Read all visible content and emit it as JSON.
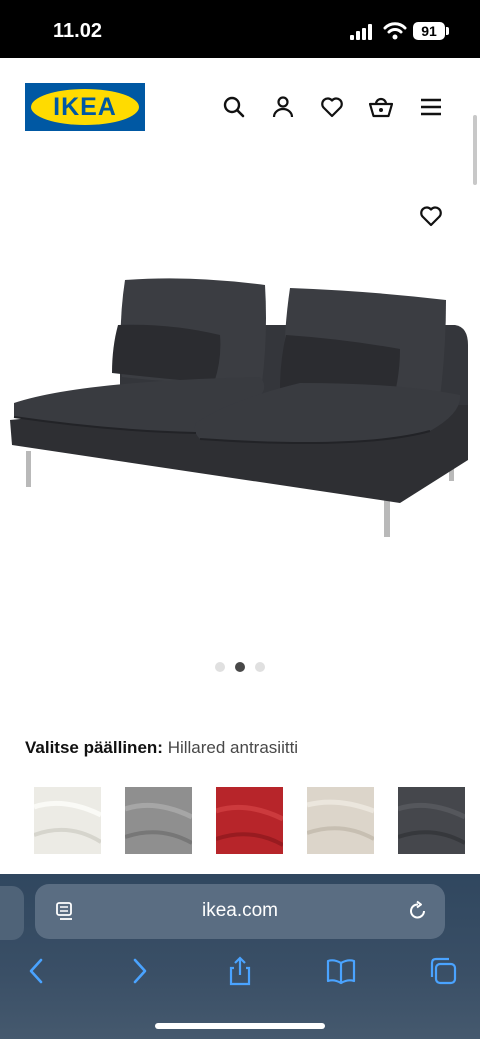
{
  "status_bar": {
    "time": "11.02",
    "battery": "91"
  },
  "header": {
    "logo_text": "IKEA",
    "icons": [
      "search-icon",
      "account-icon",
      "wishlist-heart-icon",
      "basket-icon",
      "menu-icon"
    ]
  },
  "product": {
    "image_alt": "sofa section",
    "carousel": {
      "count": 3,
      "active_index": 1
    },
    "cover_label": "Valitse päällinen:",
    "cover_value": "Hillared antrasiitti",
    "swatches": [
      {
        "color": "#ecebe5"
      },
      {
        "color": "#8f8f8f"
      },
      {
        "color": "#b7252a"
      },
      {
        "color": "#dcd5ca"
      },
      {
        "color": "#45474c"
      }
    ]
  },
  "browser": {
    "url": "ikea.com"
  },
  "colors": {
    "ikea_blue": "#0058A3",
    "ikea_yellow": "#FFDB00",
    "browser_bar": "#3a4f66",
    "link_blue": "#4aa3ff"
  }
}
